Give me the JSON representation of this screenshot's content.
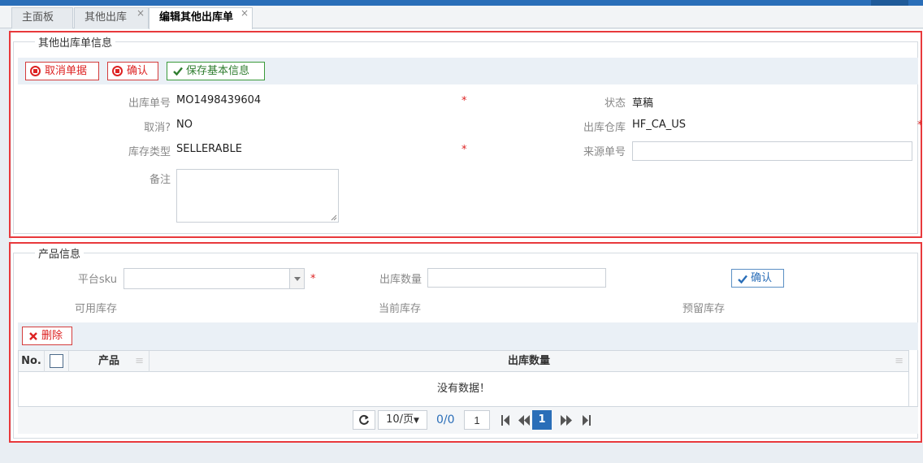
{
  "tabs": [
    {
      "label": "主面板"
    },
    {
      "label": "其他出库"
    },
    {
      "label": "编辑其他出库单"
    }
  ],
  "order_section": {
    "legend": "其他出库单信息",
    "buttons": {
      "cancel_doc": "取消单据",
      "confirm": "确认",
      "save_basic": "保存基本信息"
    },
    "fields": {
      "order_no_label": "出库单号",
      "order_no_value": "MO1498439604",
      "status_label": "状态",
      "status_value": "草稿",
      "cancelled_label": "取消?",
      "cancelled_value": "NO",
      "warehouse_label": "出库仓库",
      "warehouse_value": "HF_CA_US",
      "stock_type_label": "库存类型",
      "stock_type_value": "SELLERABLE",
      "source_no_label": "来源单号",
      "source_no_value": "",
      "remark_label": "备注",
      "remark_value": ""
    },
    "required_mark": "*"
  },
  "product_section": {
    "legend": "产品信息",
    "platform_sku_label": "平台sku",
    "platform_sku_value": "",
    "qty_label": "出库数量",
    "qty_value": "",
    "confirm_label": "确认",
    "available_stock_label": "可用库存",
    "current_stock_label": "当前库存",
    "reserved_stock_label": "预留库存",
    "delete_label": "删除",
    "grid": {
      "columns": [
        "No.",
        "产品",
        "出库数量"
      ],
      "empty_text": "没有数据！"
    },
    "pager": {
      "page_size": "10/页",
      "count": "0/0",
      "page_input": "1",
      "current_page": "1"
    }
  }
}
